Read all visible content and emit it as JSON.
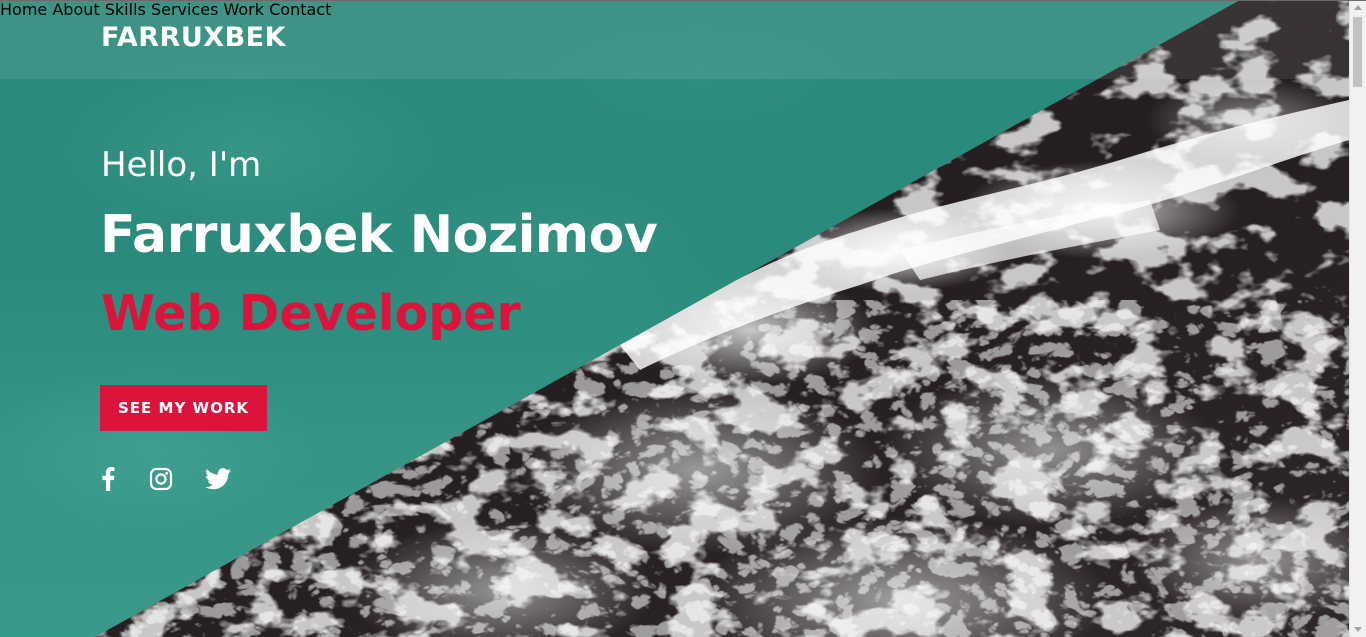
{
  "brand": {
    "logo": "FARRUXBEK"
  },
  "nav": {
    "items": [
      {
        "label": "Home"
      },
      {
        "label": "About"
      },
      {
        "label": "Skills"
      },
      {
        "label": "Services"
      },
      {
        "label": "Work"
      },
      {
        "label": "Contact"
      }
    ]
  },
  "hero": {
    "greeting": "Hello, I'm",
    "name": "Farruxbek Nozimov",
    "role": "Web Developer",
    "cta_label": "SEE MY WORK"
  },
  "social": [
    {
      "icon": "facebook-icon"
    },
    {
      "icon": "instagram-icon"
    },
    {
      "icon": "twitter-icon"
    }
  ],
  "colors": {
    "accent": "#dc143c",
    "teal": "#2a8a7b",
    "text": "#ffffff"
  }
}
